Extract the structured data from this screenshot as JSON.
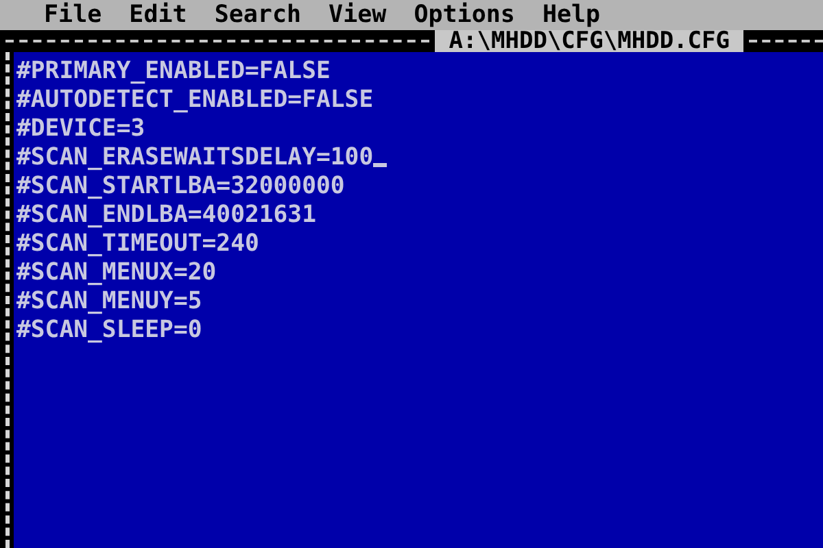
{
  "menu": [
    {
      "label": "File"
    },
    {
      "label": "Edit"
    },
    {
      "label": "Search"
    },
    {
      "label": "View"
    },
    {
      "label": "Options"
    },
    {
      "label": "Help"
    }
  ],
  "window": {
    "title": "A:\\MHDD\\CFG\\MHDD.CFG"
  },
  "lines": [
    {
      "text": "#PRIMARY_ENABLED=FALSE",
      "cursor": false
    },
    {
      "text": "#AUTODETECT_ENABLED=FALSE",
      "cursor": false
    },
    {
      "text": "#DEVICE=3",
      "cursor": false
    },
    {
      "text": "#SCAN_ERASEWAITSDELAY=100",
      "cursor": true
    },
    {
      "text": "#SCAN_STARTLBA=32000000",
      "cursor": false
    },
    {
      "text": "#SCAN_ENDLBA=40021631",
      "cursor": false
    },
    {
      "text": "#SCAN_TIMEOUT=240",
      "cursor": false
    },
    {
      "text": "#SCAN_MENUX=20",
      "cursor": false
    },
    {
      "text": "#SCAN_MENUY=5",
      "cursor": false
    },
    {
      "text": "#SCAN_SLEEP=0",
      "cursor": false
    }
  ]
}
